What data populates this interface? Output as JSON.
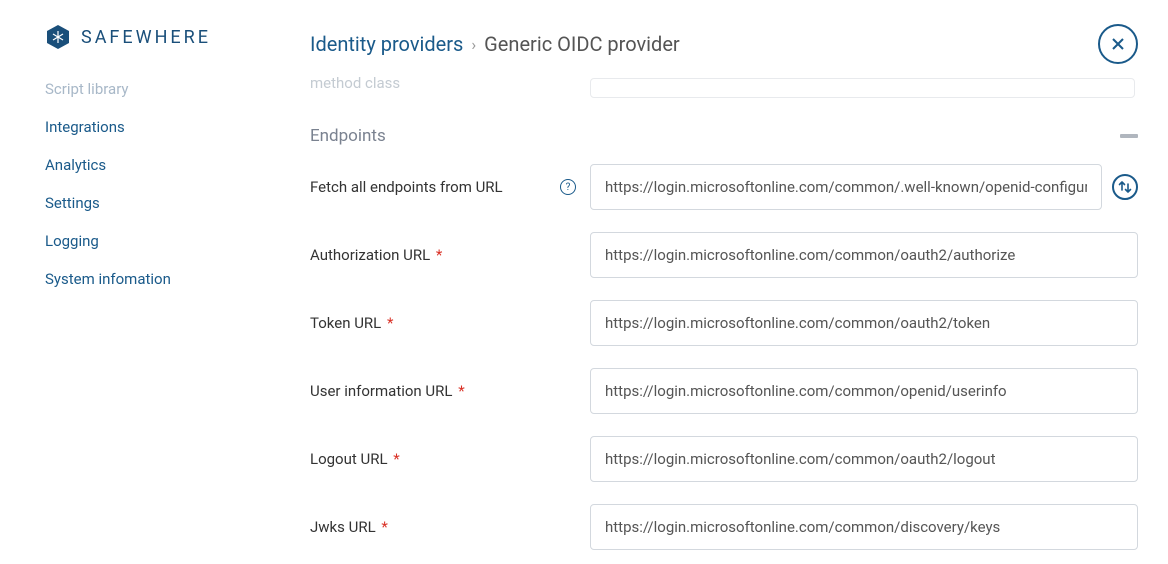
{
  "brand": "SAFEWHERE",
  "sidebar": {
    "items": [
      {
        "label": "Script library",
        "muted": true
      },
      {
        "label": "Integrations",
        "muted": false
      },
      {
        "label": "Analytics",
        "muted": false
      },
      {
        "label": "Settings",
        "muted": false
      },
      {
        "label": "Logging",
        "muted": false
      },
      {
        "label": "System infomation",
        "muted": false
      }
    ]
  },
  "breadcrumb": {
    "parent": "Identity providers",
    "current": "Generic OIDC provider"
  },
  "ghost": {
    "label": "method class"
  },
  "section": {
    "title": "Endpoints"
  },
  "form": {
    "fetch": {
      "label": "Fetch all endpoints from URL",
      "value": "https://login.microsoftonline.com/common/.well-known/openid-configuration/"
    },
    "auth": {
      "label": "Authorization URL",
      "value": "https://login.microsoftonline.com/common/oauth2/authorize"
    },
    "token": {
      "label": "Token URL",
      "value": "https://login.microsoftonline.com/common/oauth2/token"
    },
    "userinfo": {
      "label": "User information URL",
      "value": "https://login.microsoftonline.com/common/openid/userinfo"
    },
    "logout": {
      "label": "Logout URL",
      "value": "https://login.microsoftonline.com/common/oauth2/logout"
    },
    "jwks": {
      "label": "Jwks URL",
      "value": "https://login.microsoftonline.com/common/discovery/keys"
    }
  }
}
